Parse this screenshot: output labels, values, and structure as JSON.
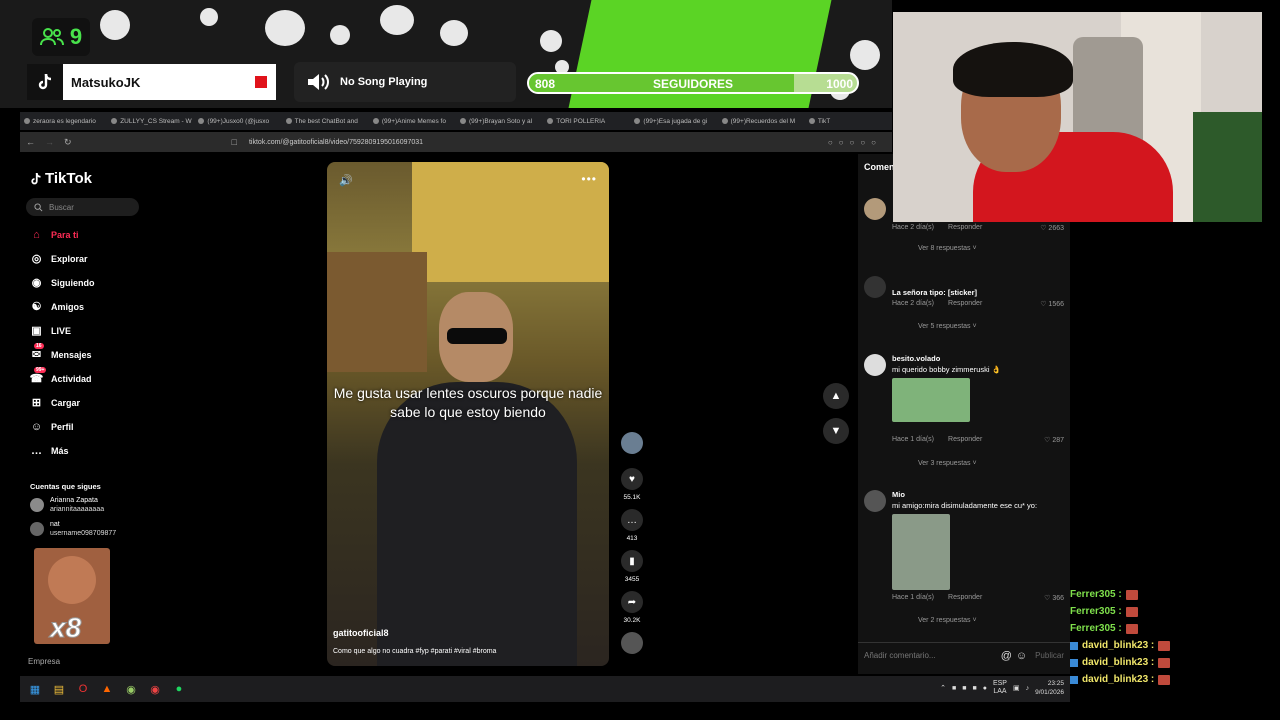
{
  "overlay": {
    "viewer_count": "9",
    "username": "MatsukoJK",
    "song": "No Song Playing",
    "followers": {
      "label": "SEGUIDORES",
      "current": "808",
      "goal": "1000",
      "fraction": 0.808
    }
  },
  "browser": {
    "tabs": [
      "zeraora es legendario",
      "ZULLYY_CS Stream - W",
      "(99+)Jusxo0 (@jusxo",
      "The best ChatBot and",
      "(99+)Anime Memes fo",
      "(99+)Brayan Soto y al",
      "TORI POLLERIA",
      "(99+)Esa jugada de gi",
      "(99+)Recuerdos del M",
      "TikT"
    ],
    "url": "tiktok.com/@gatitooficial8/video/7592809195016097031"
  },
  "tiktok": {
    "logo": "TikTok",
    "search_placeholder": "Buscar",
    "nav": [
      {
        "label": "Para ti",
        "icon": "home-icon"
      },
      {
        "label": "Explorar",
        "icon": "compass-icon"
      },
      {
        "label": "Siguiendo",
        "icon": "following-icon"
      },
      {
        "label": "Amigos",
        "icon": "friends-icon"
      },
      {
        "label": "LIVE",
        "icon": "live-icon"
      },
      {
        "label": "Mensajes",
        "icon": "messages-icon",
        "badge": "16"
      },
      {
        "label": "Actividad",
        "icon": "activity-icon",
        "badge": "99+"
      },
      {
        "label": "Cargar",
        "icon": "upload-icon"
      },
      {
        "label": "Perfil",
        "icon": "profile-icon"
      },
      {
        "label": "Más",
        "icon": "more-icon"
      }
    ],
    "following_header": "Cuentas que sigues",
    "following": [
      {
        "name": "Arianna Zapata",
        "handle": "ariannitaaaaaaaa"
      },
      {
        "name": "nat",
        "handle": "username098709877"
      }
    ],
    "meme_text": "x8",
    "footer": "Empresa",
    "video": {
      "caption": "Me gusta usar lentes oscuros porque nadie sabe lo que estoy biendo",
      "author": "gatitooficial8",
      "description": "Como que algo no cuadra #fyp #parati #viral #broma",
      "likes": "55.1K",
      "comments": "413",
      "saves": "3455",
      "shares": "30.2K"
    },
    "comments_header": "Comen",
    "comments": [
      {
        "user": "",
        "text": "",
        "time": "Hace 2 día(s)",
        "reply": "Responder",
        "likes": "2663",
        "more": "Ver 8 respuestas"
      },
      {
        "user": "La señora tipo: [sticker]",
        "text": "",
        "time": "Hace 2 día(s)",
        "reply": "Responder",
        "likes": "1566",
        "more": "Ver 5 respuestas"
      },
      {
        "user": "besito.volado",
        "text": "mi querido bobby zimmeruski 👌",
        "time": "Hace 1 día(s)",
        "reply": "Responder",
        "likes": "287",
        "more": "Ver 3 respuestas"
      },
      {
        "user": "Mio",
        "text": "mi amigo:mira disimuladamente ese cu* yo:",
        "time": "Hace 1 día(s)",
        "reply": "Responder",
        "likes": "366",
        "more": "Ver 2 respuestas"
      }
    ],
    "add_comment_placeholder": "Añadir comentario...",
    "publish": "Publicar"
  },
  "chat": [
    {
      "user": "Ferrer305 :",
      "color": "#7fe04c"
    },
    {
      "user": "Ferrer305 :",
      "color": "#7fe04c"
    },
    {
      "user": "Ferrer305 :",
      "color": "#7fe04c"
    },
    {
      "user": "david_blink23 :",
      "color": "#f0e66a"
    },
    {
      "user": "david_blink23 :",
      "color": "#f0e66a"
    },
    {
      "user": "david_blink23 :",
      "color": "#f0e66a"
    }
  ],
  "taskbar": {
    "lang": "ESP",
    "region": "LAA",
    "time": "23:25",
    "date": "9/01/2026"
  }
}
